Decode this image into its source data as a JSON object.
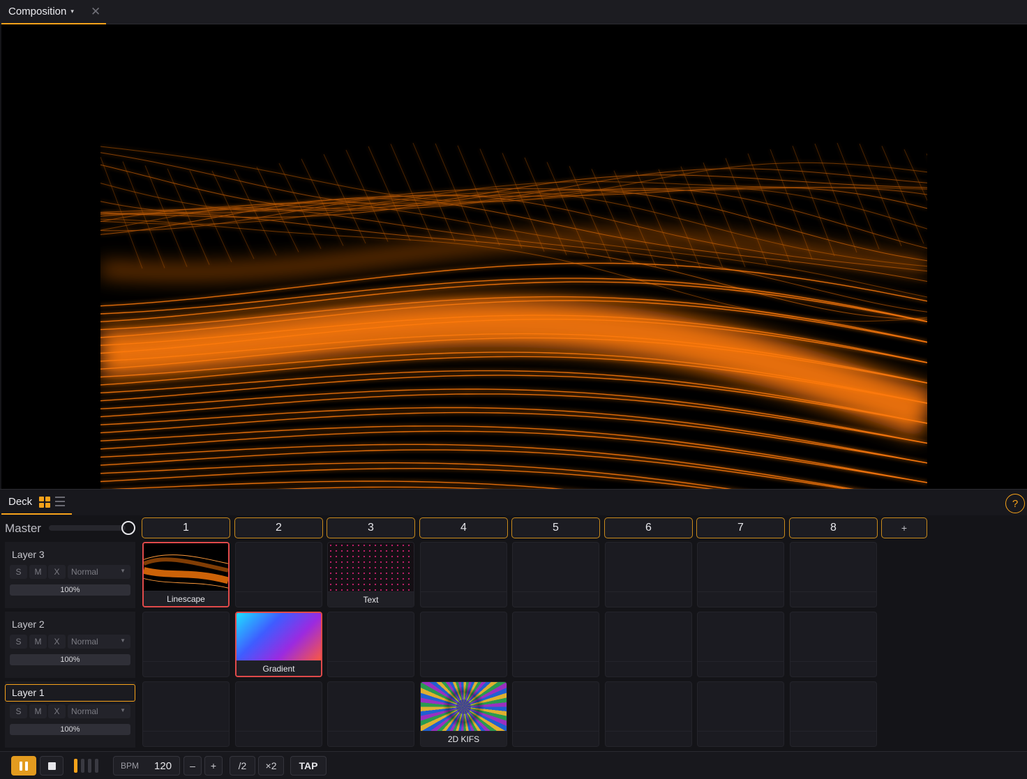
{
  "composition_tab": {
    "title": "Composition",
    "caret": "▾",
    "close": "✕"
  },
  "deck": {
    "tab_label": "Deck",
    "help": "?",
    "master_label": "Master",
    "columns": [
      "1",
      "2",
      "3",
      "4",
      "5",
      "6",
      "7",
      "8"
    ],
    "add_column": "+",
    "layers": [
      {
        "name": "Layer 3",
        "solo": "S",
        "mute": "M",
        "clear": "X",
        "blend": "Normal",
        "opacity": "100%"
      },
      {
        "name": "Layer 2",
        "solo": "S",
        "mute": "M",
        "clear": "X",
        "blend": "Normal",
        "opacity": "100%"
      },
      {
        "name": "Layer 1",
        "solo": "S",
        "mute": "M",
        "clear": "X",
        "blend": "Normal",
        "opacity": "100%"
      }
    ],
    "clips": {
      "linescape": "Linescape",
      "text": "Text",
      "gradient": "Gradient",
      "kifs": "2D KIFS"
    }
  },
  "transport": {
    "bpm_label": "BPM",
    "bpm_value": "120",
    "minus": "–",
    "plus": "+",
    "half": "/2",
    "double": "×2",
    "tap": "TAP",
    "beat_count": 4,
    "active_beat": 1
  },
  "colors": {
    "accent": "#f7a21a",
    "selected_clip": "#e04a4a",
    "wave": "#ff7a0a"
  }
}
